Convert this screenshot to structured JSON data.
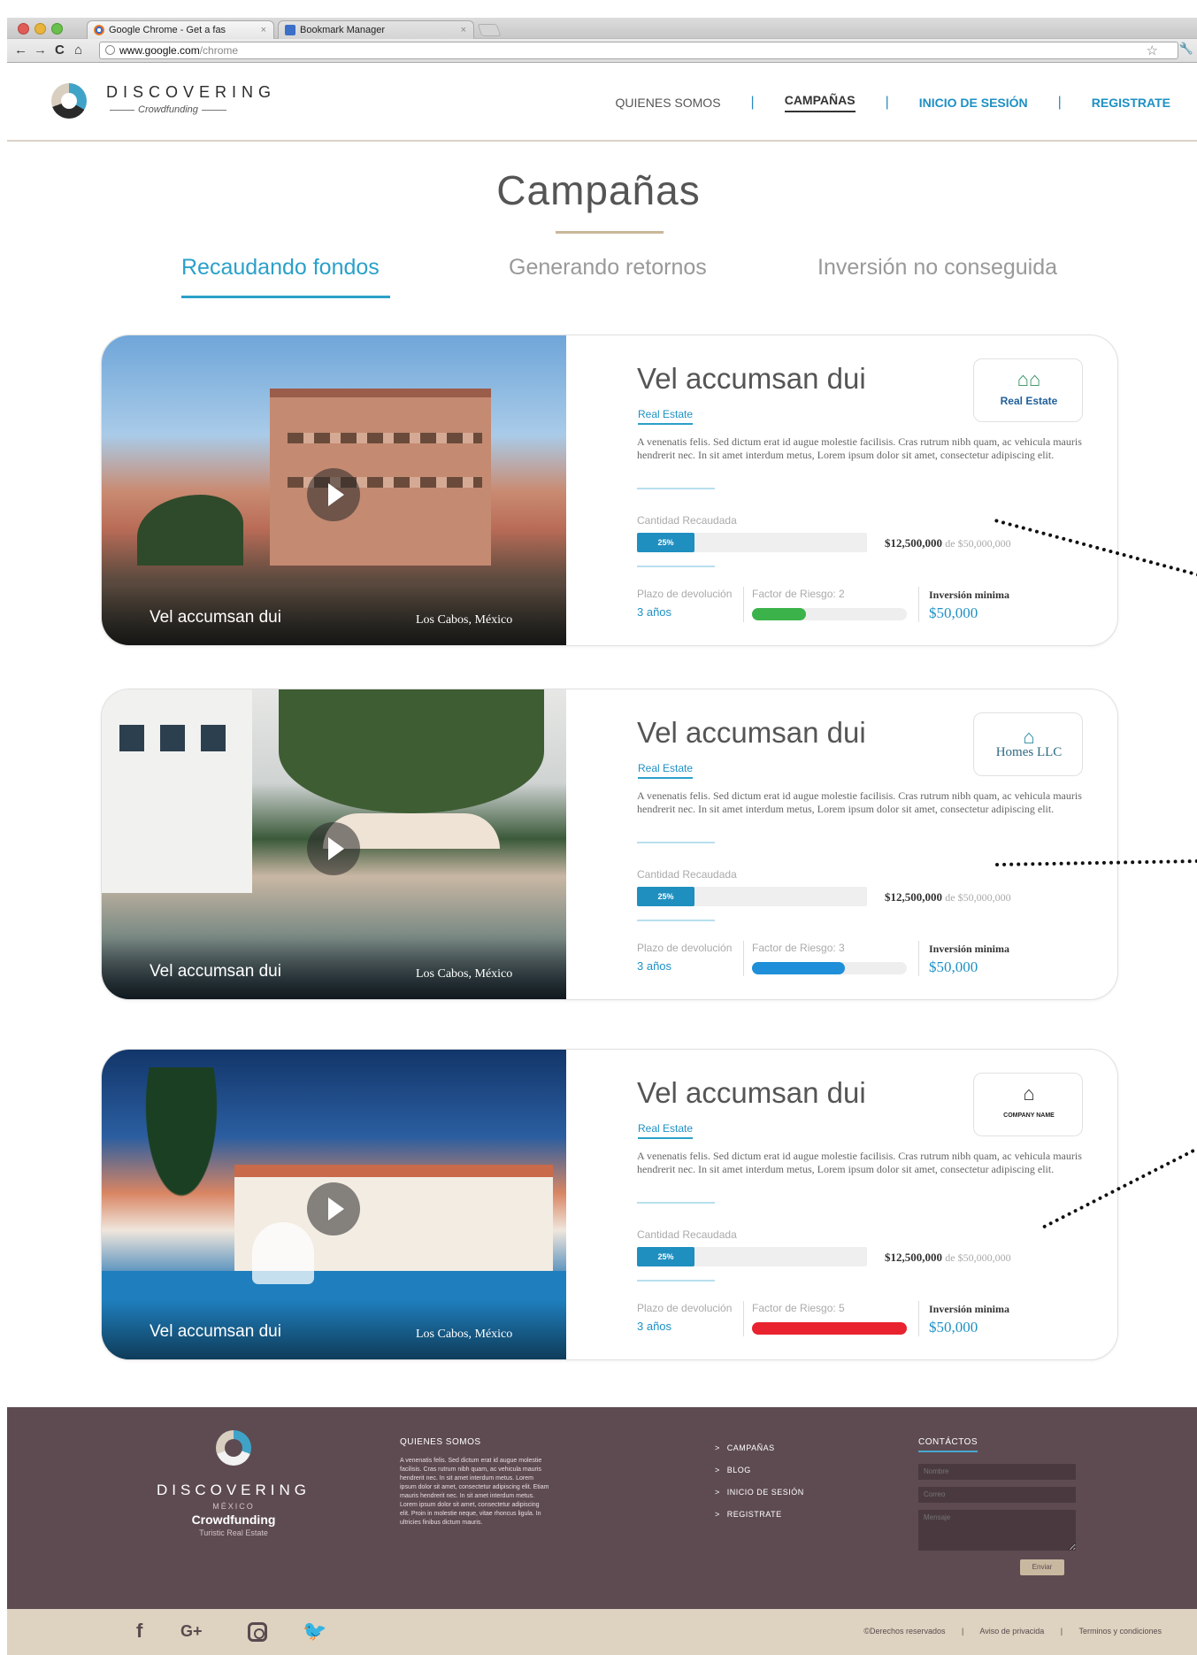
{
  "browser": {
    "tabs": [
      {
        "label": "Google Chrome - Get a fas"
      },
      {
        "label": "Bookmark Manager"
      }
    ],
    "url_host": "www.google.com",
    "url_path": "/chrome",
    "close_glyph": "×",
    "nav": {
      "back": "←",
      "forward": "→",
      "reload": "C",
      "home": "⌂",
      "star": "☆",
      "wrench": "🔧"
    }
  },
  "header": {
    "brand": "DISCOVERING",
    "brand_sub": "Crowdfunding",
    "nav": {
      "quienes": "QUIENES SOMOS",
      "campanas": "CAMPAÑAS",
      "login": "INICIO DE SESIÓN",
      "register": "REGISTRATE",
      "separator": "|"
    }
  },
  "page": {
    "title": "Campañas",
    "filter_tabs": [
      {
        "label": "Recaudando fondos",
        "active": true
      },
      {
        "label": "Generando retornos",
        "active": false
      },
      {
        "label": "Inversión no conseguida",
        "active": false
      }
    ]
  },
  "campaigns": [
    {
      "title": "Vel accumsan dui",
      "category": "Real Estate",
      "description": "A venenatis felis. Sed dictum erat id augue molestie facilisis. Cras rutrum nibh quam, ac vehicula mauris hendrerit nec. In sit amet interdum metus, Lorem ipsum dolor sit amet, consectetur adipiscing elit.",
      "photo_caption": "Vel accumsan dui",
      "location": "Los Cabos, México",
      "raised_label": "Cantidad Recaudada",
      "raised_percent_label": "25%",
      "raised_fraction": 0.25,
      "raised_amount": "$12,500,000",
      "goal_text": "de $50,000,000",
      "term_label": "Plazo de devolución",
      "term_value": "3 años",
      "risk_label": "Factor de Riesgo: 2",
      "risk_fraction": 0.35,
      "risk_color": "#3cb34a",
      "min_label": "Inversión minima",
      "min_value": "$50,000",
      "partner_icon": "house-roofs-icon",
      "partner_glyph": "⌂⌂",
      "partner_name": "Real Estate"
    },
    {
      "title": "Vel accumsan dui",
      "category": "Real Estate",
      "description": "A venenatis felis. Sed dictum erat id augue molestie facilisis. Cras rutrum nibh quam, ac vehicula mauris hendrerit nec. In sit amet interdum metus, Lorem ipsum dolor sit amet, consectetur adipiscing elit.",
      "photo_caption": "Vel accumsan dui",
      "location": "Los Cabos, México",
      "raised_label": "Cantidad Recaudada",
      "raised_percent_label": "25%",
      "raised_fraction": 0.25,
      "raised_amount": "$12,500,000",
      "goal_text": "de $50,000,000",
      "term_label": "Plazo de devolución",
      "term_value": "3 años",
      "risk_label": "Factor de Riesgo: 3",
      "risk_fraction": 0.6,
      "risk_color": "#1e8fd8",
      "min_label": "Inversión minima",
      "min_value": "$50,000",
      "partner_icon": "roof-icon",
      "partner_glyph": "⌂",
      "partner_name": "Homes LLC"
    },
    {
      "title": "Vel accumsan dui",
      "category": "Real Estate",
      "description": "A venenatis felis. Sed dictum erat id augue molestie facilisis. Cras rutrum nibh quam, ac vehicula mauris hendrerit nec. In sit amet interdum metus, Lorem ipsum dolor sit amet, consectetur adipiscing elit.",
      "photo_caption": "Vel accumsan dui",
      "location": "Los Cabos, México",
      "raised_label": "Cantidad Recaudada",
      "raised_percent_label": "25%",
      "raised_fraction": 0.25,
      "raised_amount": "$12,500,000",
      "goal_text": "de $50,000,000",
      "term_label": "Plazo de devolución",
      "term_value": "3 años",
      "risk_label": "Factor de Riesgo: 5",
      "risk_fraction": 1.0,
      "risk_color": "#e8232f",
      "min_label": "Inversión minima",
      "min_value": "$50,000",
      "partner_icon": "house-outline-icon",
      "partner_glyph": "⌂",
      "partner_name": "COMPANY NAME"
    }
  ],
  "footer": {
    "brand": "DISCOVERING",
    "brand_country": "MÉXICO",
    "brand_name": "Crowdfunding",
    "brand_tag": "Turistic Real Estate",
    "about_title": "QUIENES SOMOS",
    "about_text": "A venenatis felis. Sed dictum erat id augue molestie facilisis. Cras rutrum nibh quam, ac vehicula mauris hendrerit nec. In sit amet interdum metus. Lorem ipsum dolor sit amet, consectetur adipiscing elit. Etiam mauris hendrerit nec. In sit amet interdum metus. Lorem ipsum dolor sit amet, consectetur adipiscing elit. Proin in molestie neque, vitae rhoncus ligula. In ultricies finibus dictum mauris.",
    "links": [
      "CAMPAÑAS",
      "BLOG",
      "INICIO DE SESIÓN",
      "REGISTRATE"
    ],
    "link_chevron": ">",
    "contact_title": "CONTÁCTOS",
    "contact_name_placeholder": "Nombre",
    "contact_mail_placeholder": "Correo",
    "contact_msg_placeholder": "Mensaje",
    "send_label": "Enviar"
  },
  "bottom": {
    "social": {
      "facebook": "f",
      "google_plus": "G+",
      "twitter": "🐦"
    },
    "legal": [
      "©Derechos reservados",
      "Aviso de privacida",
      "Terminos y condiciones"
    ],
    "legal_sep": "|"
  }
}
